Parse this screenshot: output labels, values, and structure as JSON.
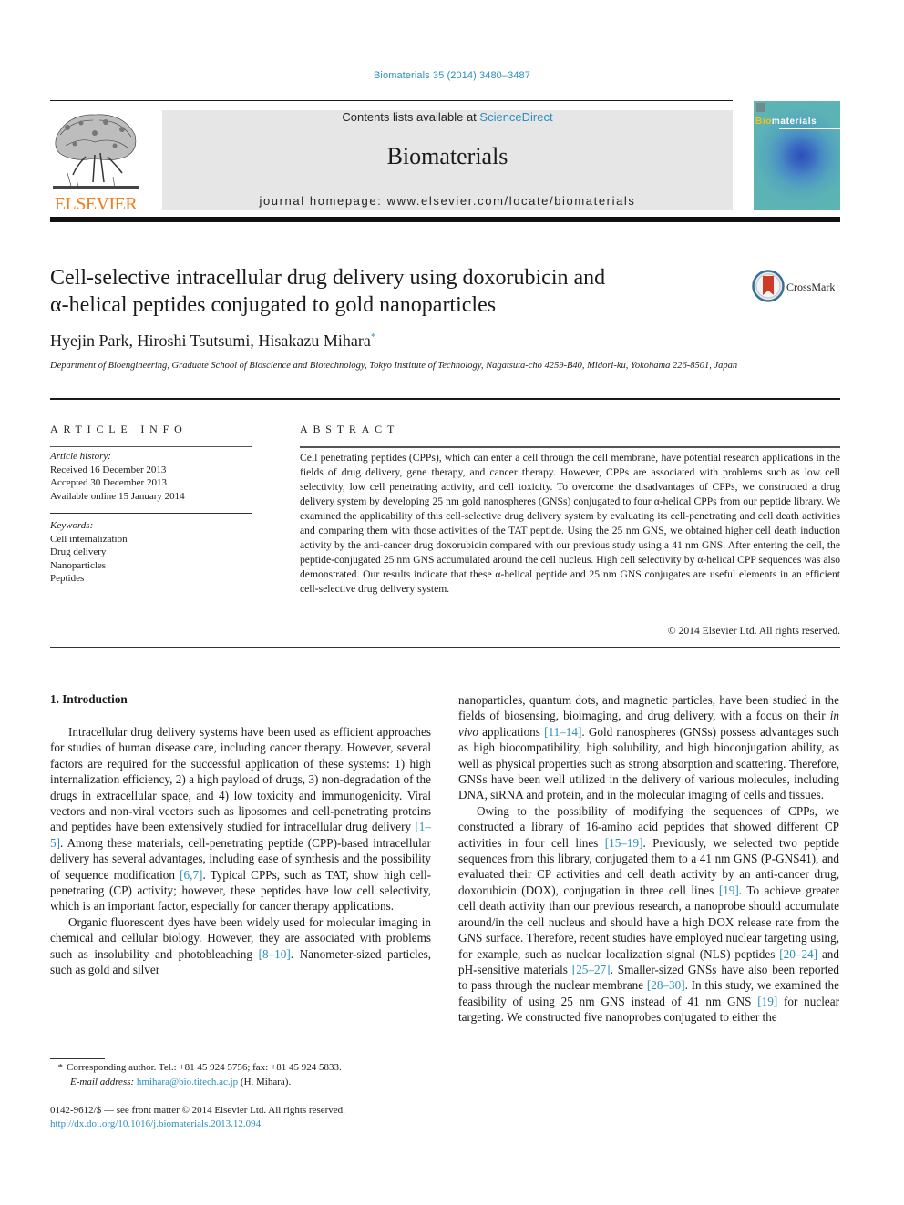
{
  "citation": "Biomaterials 35 (2014) 3480–3487",
  "header": {
    "publisher_logo_text": "ELSEVIER",
    "contents_prefix": "Contents lists available at ",
    "contents_link": "ScienceDirect",
    "journal_name": "Biomaterials",
    "homepage_label": "journal homepage: ",
    "homepage_url": "www.elsevier.com/locate/biomaterials",
    "cover_title_highlight": "Bio",
    "cover_title_rest": "materials",
    "brand_orange": "#f07d1a",
    "link_blue": "#2a8fbd"
  },
  "crossmark": {
    "label": "CrossMark"
  },
  "article": {
    "title_line1": "Cell-selective intracellular drug delivery using doxorubicin and",
    "title_line2": "α-helical peptides conjugated to gold nanoparticles",
    "authors": "Hyejin Park, Hiroshi Tsutsumi, Hisakazu Mihara",
    "corresponding_mark": "*",
    "affiliation": "Department of Bioengineering, Graduate School of Bioscience and Biotechnology, Tokyo Institute of Technology, Nagatsuta-cho 4259-B40, Midori-ku, Yokohama 226-8501, Japan"
  },
  "article_info": {
    "heading": "ARTICLE INFO",
    "history_label": "Article history:",
    "history": [
      "Received 16 December 2013",
      "Accepted 30 December 2013",
      "Available online 15 January 2014"
    ],
    "keywords_label": "Keywords:",
    "keywords": [
      "Cell internalization",
      "Drug delivery",
      "Nanoparticles",
      "Peptides"
    ]
  },
  "abstract": {
    "heading": "ABSTRACT",
    "text": "Cell penetrating peptides (CPPs), which can enter a cell through the cell membrane, have potential research applications in the fields of drug delivery, gene therapy, and cancer therapy. However, CPPs are associated with problems such as low cell selectivity, low cell penetrating activity, and cell toxicity. To overcome the disadvantages of CPPs, we constructed a drug delivery system by developing 25 nm gold nanospheres (GNSs) conjugated to four α-helical CPPs from our peptide library. We examined the applicability of this cell-selective drug delivery system by evaluating its cell-penetrating and cell death activities and comparing them with those activities of the TAT peptide. Using the 25 nm GNS, we obtained higher cell death induction activity by the anti-cancer drug doxorubicin compared with our previous study using a 41 nm GNS. After entering the cell, the peptide-conjugated 25 nm GNS accumulated around the cell nucleus. High cell selectivity by α-helical CPP sequences was also demonstrated. Our results indicate that these α-helical peptide and 25 nm GNS conjugates are useful elements in an efficient cell-selective drug delivery system.",
    "copyright": "© 2014 Elsevier Ltd. All rights reserved."
  },
  "introduction": {
    "heading": "1.  Introduction",
    "p1": [
      {
        "t": "Intracellular drug delivery systems have been used as efficient approaches for studies of human disease care, including cancer therapy. However, several factors are required for the successful application of these systems: 1) high internalization efficiency, 2) a high payload of drugs, 3) non-degradation of the drugs in extra­cellular space, and 4) low toxicity and immunogenicity. Viral vec­tors and non-viral vectors such as liposomes and cell-penetrating proteins and peptides have been extensively studied for intracel­lular drug delivery "
      },
      {
        "ref": "[1–5]"
      },
      {
        "t": ". Among these materials, cell-penetrating peptide (CPP)-based intracellular delivery has several advantages, including ease of synthesis and the possibility of sequence modi­fication "
      },
      {
        "ref": "[6,7]"
      },
      {
        "t": ". Typical CPPs, such as TAT, show high cell-penetrating (CP) activity; however, these peptides have low cell selectivity, which is an important factor, especially for cancer therapy applications."
      }
    ],
    "p2a": [
      {
        "t": "Organic fluorescent dyes have been widely used for molecular imaging in chemical and cellular biology. However, they are associated with problems such as insolubility and photobleaching "
      },
      {
        "ref": "[8–10]"
      },
      {
        "t": ". Nanometer-sized particles, such as gold and silver"
      }
    ],
    "p2b": [
      {
        "t": "nanoparticles, quantum dots, and magnetic particles, have been studied in the fields of biosensing, bioimaging, and drug delivery, with a focus on their "
      },
      {
        "i": "in vivo"
      },
      {
        "t": " applications "
      },
      {
        "ref": "[11–14]"
      },
      {
        "t": ". Gold nanospheres (GNSs) possess advantages such as high biocompatibility, high solubility, and high bioconjugation ability, as well as physical properties such as strong absorption and scattering. Therefore, GNSs have been well utilized in the delivery of various molecules, including DNA, siRNA and protein, and in the molecular imaging of cells and tissues."
      }
    ],
    "p3": [
      {
        "t": "Owing to the possibility of modifying the sequences of CPPs, we constructed a library of 16-amino acid peptides that showed different CP activities in four cell lines "
      },
      {
        "ref": "[15–19]"
      },
      {
        "t": ". Previously, we selected two peptide sequences from this library, conjugated them to a 41 nm GNS (P-GNS41), and evaluated their CP activities and cell death activity by an anti-cancer drug, doxorubicin (DOX), conju­gation in three cell lines "
      },
      {
        "ref": "[19]"
      },
      {
        "t": ". To achieve greater cell death activity than our previous research, a nanoprobe should accumulate around/in the cell nucleus and should have a high DOX release rate from the GNS surface. Therefore, recent studies have employed nuclear targeting using, for example, such as nuclear localization signal (NLS) peptides "
      },
      {
        "ref": "[20–24]"
      },
      {
        "t": " and pH-sensitive materials "
      },
      {
        "ref": "[25–27]"
      },
      {
        "t": ". Smaller-sized GNSs have also been reported to pass through the nuclear membrane "
      },
      {
        "ref": "[28–30]"
      },
      {
        "t": ". In this study, we examined the feasi­bility of using 25 nm GNS instead of 41 nm GNS "
      },
      {
        "ref": "[19]"
      },
      {
        "t": " for nuclear targeting. We constructed five nanoprobes conjugated to either the"
      }
    ]
  },
  "footnote": {
    "star": "*",
    "corresponding": "Corresponding author. Tel.: +81 45 924 5756; fax: +81 45 924 5833.",
    "email_label": "E-mail address:",
    "email": "hmihara@bio.titech.ac.jp",
    "email_suffix": " (H. Mihara)."
  },
  "front_matter": {
    "issn_line": "0142-9612/$ — see front matter © 2014 Elsevier Ltd. All rights reserved.",
    "doi": "http://dx.doi.org/10.1016/j.biomaterials.2013.12.094"
  }
}
